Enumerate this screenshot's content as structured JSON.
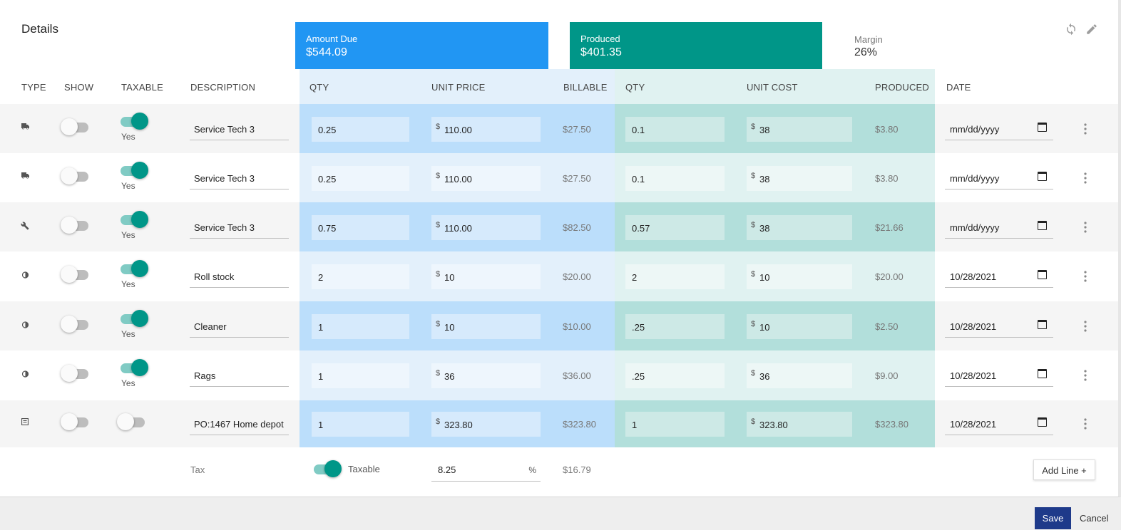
{
  "details_title": "Details",
  "summary": {
    "amount_due_label": "Amount Due",
    "amount_due_value": "$544.09",
    "produced_label": "Produced",
    "produced_value": "$401.35",
    "margin_label": "Margin",
    "margin_value": "26%"
  },
  "colors": {
    "amount_due_tile": "#2196f3",
    "produced_tile": "#009688",
    "billable_band": "#e3f0fb",
    "produced_band": "#e0f2f1",
    "toggle_on": "#009688",
    "save_button": "#1e3a8a"
  },
  "headers": {
    "type": "TYPE",
    "show": "SHOW",
    "taxable": "TAXABLE",
    "description": "DESCRIPTION",
    "qty_bill": "QTY",
    "unit_price": "UNIT PRICE",
    "billable": "BILLABLE",
    "qty_prod": "QTY",
    "unit_cost": "UNIT COST",
    "produced": "PRODUCED",
    "date": "DATE"
  },
  "currency_symbol": "$",
  "rows": [
    {
      "type_icon": "truck-icon",
      "show": false,
      "taxable": true,
      "taxable_label": "Yes",
      "description": "Service Tech 3",
      "qty": "0.25",
      "unit_price": "110.00",
      "billable": "$27.50",
      "prod_qty": "0.1",
      "unit_cost": "38",
      "produced": "$3.80",
      "date": "mm/dd/yyyy"
    },
    {
      "type_icon": "truck-icon",
      "show": false,
      "taxable": true,
      "taxable_label": "Yes",
      "description": "Service Tech 3",
      "qty": "0.25",
      "unit_price": "110.00",
      "billable": "$27.50",
      "prod_qty": "0.1",
      "unit_cost": "38",
      "produced": "$3.80",
      "date": "mm/dd/yyyy"
    },
    {
      "type_icon": "wrench-icon",
      "show": false,
      "taxable": true,
      "taxable_label": "Yes",
      "description": "Service Tech 3",
      "qty": "0.75",
      "unit_price": "110.00",
      "billable": "$82.50",
      "prod_qty": "0.57",
      "unit_cost": "38",
      "produced": "$21.66",
      "date": "mm/dd/yyyy"
    },
    {
      "type_icon": "drop-icon",
      "show": false,
      "taxable": true,
      "taxable_label": "Yes",
      "description": "Roll stock",
      "qty": "2",
      "unit_price": "10",
      "billable": "$20.00",
      "prod_qty": "2",
      "unit_cost": "10",
      "produced": "$20.00",
      "date": "10/28/2021"
    },
    {
      "type_icon": "drop-icon",
      "show": false,
      "taxable": true,
      "taxable_label": "Yes",
      "description": "Cleaner",
      "qty": "1",
      "unit_price": "10",
      "billable": "$10.00",
      "prod_qty": ".25",
      "unit_cost": "10",
      "produced": "$2.50",
      "date": "10/28/2021"
    },
    {
      "type_icon": "drop-icon",
      "show": false,
      "taxable": true,
      "taxable_label": "Yes",
      "description": "Rags",
      "qty": "1",
      "unit_price": "36",
      "billable": "$36.00",
      "prod_qty": ".25",
      "unit_cost": "36",
      "produced": "$9.00",
      "date": "10/28/2021"
    },
    {
      "type_icon": "receipt-icon",
      "show": false,
      "taxable": false,
      "taxable_label": "",
      "description": "PO:1467 Home depot",
      "qty": "1",
      "unit_price": "323.80",
      "billable": "$323.80",
      "prod_qty": "1",
      "unit_cost": "323.80",
      "produced": "$323.80",
      "date": "10/28/2021"
    }
  ],
  "tax": {
    "label": "Tax",
    "taxable_on": true,
    "taxable_label": "Taxable",
    "rate": "8.25",
    "percent_symbol": "%",
    "amount": "$16.79"
  },
  "buttons": {
    "add_line": "Add Line +",
    "save": "Save",
    "cancel": "Cancel"
  },
  "icons": {
    "refresh": "refresh-icon",
    "edit": "pencil-icon",
    "row_menu": "more-vert-icon",
    "calendar": "calendar-icon"
  }
}
